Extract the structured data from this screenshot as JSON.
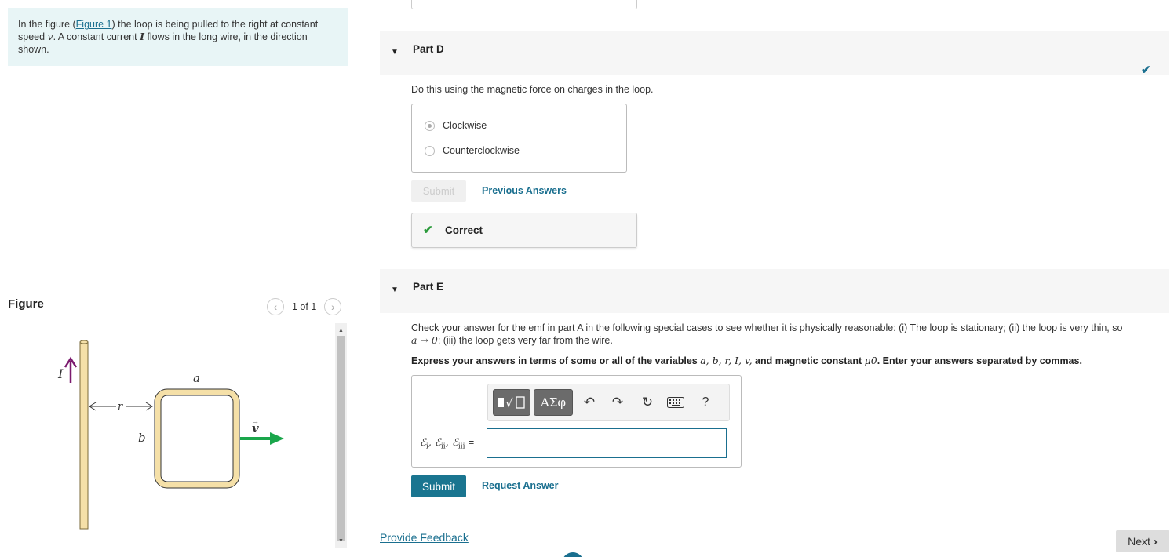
{
  "problem": {
    "text_1": "In the figure (",
    "figure_link": "Figure 1",
    "text_2": ") the loop is being pulled to the right at constant speed ",
    "var_v": "v",
    "text_3": ". A constant current ",
    "var_I": "I",
    "text_4": " flows in the long wire, in the direction shown."
  },
  "figure": {
    "title": "Figure",
    "counter": "1 of 1",
    "labels": {
      "current": "I",
      "a": "a",
      "b": "b",
      "r": "r",
      "v": "v"
    },
    "colors": {
      "wire": "#f5e0a8",
      "arrow_current": "#7b1a6e",
      "arrow_velocity": "#1aa64b"
    }
  },
  "partD": {
    "title": "Part D",
    "instruction": "Do this using the magnetic force on charges in the loop.",
    "options": [
      "Clockwise",
      "Counterclockwise"
    ],
    "selected": "Clockwise",
    "submit_label": "Submit",
    "prev_answers": "Previous Answers",
    "feedback": "Correct"
  },
  "partE": {
    "title": "Part E",
    "instruction_1": "Check your answer for the emf in part A in the following special cases to see whether it is physically reasonable: (i) The loop is stationary; (ii) the loop is very thin, so",
    "instruction_2_math": "a → 0",
    "instruction_2_rest": "; (iii) the loop gets very far from the wire.",
    "express_prefix": "Express your answers in terms of some or all of the variables ",
    "express_vars": "a, b, r, I, v,",
    "express_mid": " and magnetic constant ",
    "express_mu": "μ0",
    "express_suffix": ". Enter your answers separated by commas.",
    "toolbar": {
      "greek": "ΑΣφ",
      "help": "?"
    },
    "emf_symbol": "ℰ",
    "emf_subs": [
      "i",
      "ii",
      "iii"
    ],
    "emf_eq": "=",
    "input_value": "",
    "submit_label": "Submit",
    "request_answer": "Request Answer"
  },
  "footer": {
    "feedback_link": "Provide Feedback",
    "next_label": "Next"
  }
}
